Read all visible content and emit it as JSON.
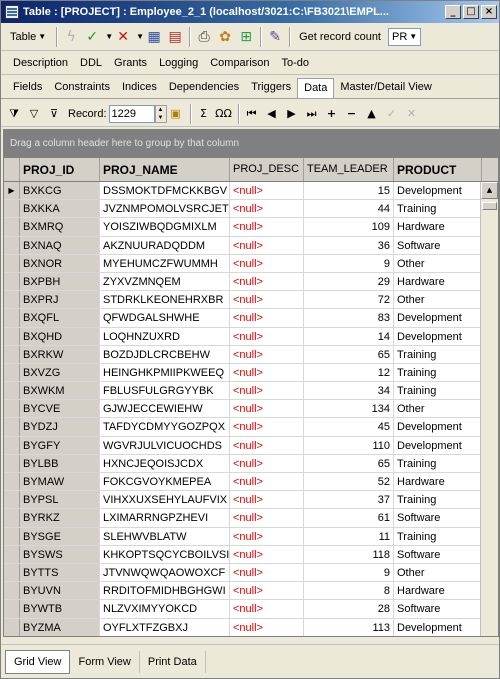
{
  "window": {
    "title": "Table : [PROJECT] : Employee_2_1 (localhost/3021:C:\\FB3021\\EMPL..."
  },
  "toolbar": {
    "table_label": "Table",
    "get_record_count": "Get record count",
    "pr_select": "PR"
  },
  "tabs_top": [
    "Description",
    "DDL",
    "Grants",
    "Logging",
    "Comparison",
    "To-do"
  ],
  "tabs_bottom": [
    "Fields",
    "Constraints",
    "Indices",
    "Dependencies",
    "Triggers",
    "Data",
    "Master/Detail View"
  ],
  "navbar": {
    "record_label": "Record:",
    "record_value": "1229"
  },
  "grid": {
    "group_hint": "Drag a column header here to group by that column",
    "columns": [
      "PROJ_ID",
      "PROJ_NAME",
      "PROJ_DESC",
      "TEAM_LEADER",
      "PRODUCT"
    ],
    "null_text": "<null>",
    "rows": [
      [
        "BXKCG",
        "DSSMOKTDFMCKKBGV",
        "<null>",
        "15",
        "Development"
      ],
      [
        "BXKKA",
        "JVZNMPOMOLVSRCJET",
        "<null>",
        "44",
        "Training"
      ],
      [
        "BXMRQ",
        "YOISZIWBQDGMIXLM",
        "<null>",
        "109",
        "Hardware"
      ],
      [
        "BXNAQ",
        "AKZNUURADQDDM",
        "<null>",
        "36",
        "Software"
      ],
      [
        "BXNOR",
        "MYEHUMCZFWUMMH",
        "<null>",
        "9",
        "Other"
      ],
      [
        "BXPBH",
        "ZYXVZMNQEM",
        "<null>",
        "29",
        "Hardware"
      ],
      [
        "BXPRJ",
        "STDRKLKEONEHRXBR",
        "<null>",
        "72",
        "Other"
      ],
      [
        "BXQFL",
        "QFWDGALSHWHE",
        "<null>",
        "83",
        "Development"
      ],
      [
        "BXQHD",
        "LOQHNZUXRD",
        "<null>",
        "14",
        "Development"
      ],
      [
        "BXRKW",
        "BOZDJDLCRCBEHW",
        "<null>",
        "65",
        "Training"
      ],
      [
        "BXVZG",
        "HEINGHKPMIIPKWEEQ",
        "<null>",
        "12",
        "Training"
      ],
      [
        "BXWKM",
        "FBLUSFULGRGYYBK",
        "<null>",
        "34",
        "Training"
      ],
      [
        "BYCVE",
        "GJWJECCEWIEHW",
        "<null>",
        "134",
        "Other"
      ],
      [
        "BYDZJ",
        "TAFDYCDMYYGOZPQX",
        "<null>",
        "45",
        "Development"
      ],
      [
        "BYGFY",
        "WGVRJULVICUOCHDS",
        "<null>",
        "110",
        "Development"
      ],
      [
        "BYLBB",
        "HXNCJEQOISJCDX",
        "<null>",
        "65",
        "Training"
      ],
      [
        "BYMAW",
        "FOKCGVOYKMEPEA",
        "<null>",
        "52",
        "Hardware"
      ],
      [
        "BYPSL",
        "VIHXXUXSEHYLAUFVIX",
        "<null>",
        "37",
        "Training"
      ],
      [
        "BYRKZ",
        "LXIMARRNGPZHEVI",
        "<null>",
        "61",
        "Software"
      ],
      [
        "BYSGE",
        "SLEHWVBLATW",
        "<null>",
        "11",
        "Training"
      ],
      [
        "BYSWS",
        "KHKOPTSQCYCBOILVSI",
        "<null>",
        "118",
        "Software"
      ],
      [
        "BYTTS",
        "JTVNWQWQAOWOXCF",
        "<null>",
        "9",
        "Other"
      ],
      [
        "BYUVN",
        "RRDITOFMIDHBGHGWI",
        "<null>",
        "8",
        "Hardware"
      ],
      [
        "BYWTB",
        "NLZVXIMYYOKCD",
        "<null>",
        "28",
        "Software"
      ],
      [
        "BYZMA",
        "OYFLXTFZGBXJ",
        "<null>",
        "113",
        "Development"
      ]
    ]
  },
  "bottom_tabs": [
    "Grid View",
    "Form View",
    "Print Data"
  ]
}
